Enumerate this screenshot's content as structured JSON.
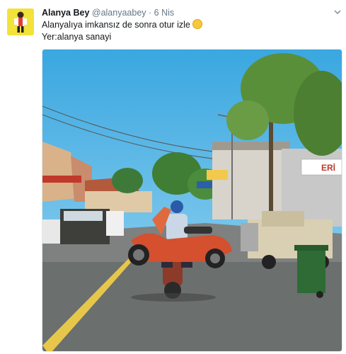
{
  "tweet": {
    "author_name": "Alanya Bey",
    "author_handle": "@alanyaabey",
    "separator": "·",
    "date": "6 Nis",
    "line1": "Alanyalıya imkansız de sonra otur izle",
    "line2": "Yer:alanya sanayi"
  },
  "media": {
    "sign_text": "ERİ"
  },
  "icons": {
    "emoji": "face-with-tears-of-joy-icon",
    "caret": "chevron-down-icon",
    "avatar": "avatar-illustration"
  },
  "colors": {
    "name": "#14171a",
    "secondary": "#657786",
    "sky": "#4fb8e6"
  }
}
